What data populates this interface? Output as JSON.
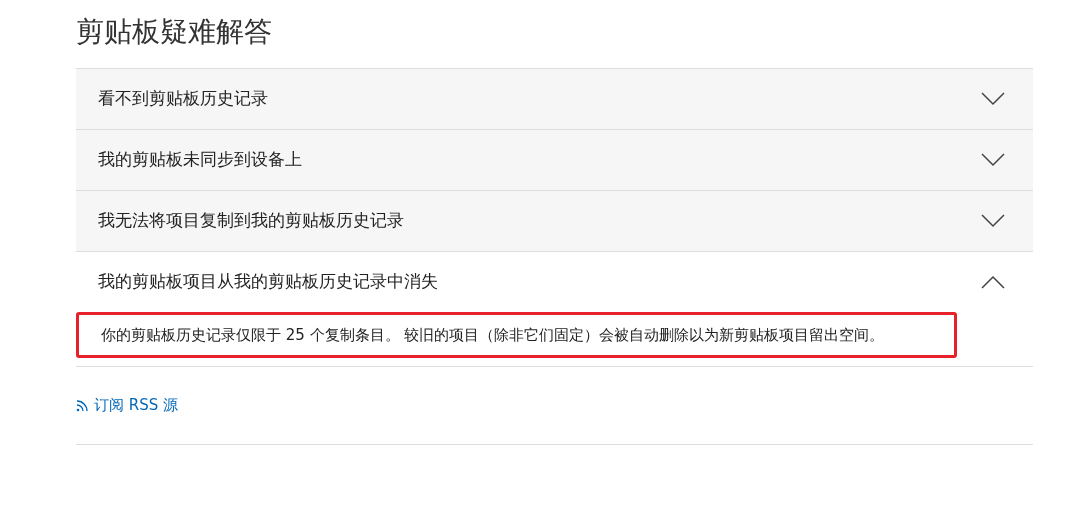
{
  "title": "剪贴板疑难解答",
  "items": [
    {
      "title": "看不到剪贴板历史记录",
      "expanded": false
    },
    {
      "title": "我的剪贴板未同步到设备上",
      "expanded": false
    },
    {
      "title": "我无法将项目复制到我的剪贴板历史记录",
      "expanded": false
    },
    {
      "title": "我的剪贴板项目从我的剪贴板历史记录中消失",
      "expanded": true,
      "answer": {
        "text": "你的剪贴板历史记录仅限于 25 个复制条目。 较旧的项目（除非它们固定）会被自动删除以为新剪贴板项目留出空间。",
        "highlighted": true
      }
    }
  ],
  "rss_link": "订阅 RSS 源"
}
